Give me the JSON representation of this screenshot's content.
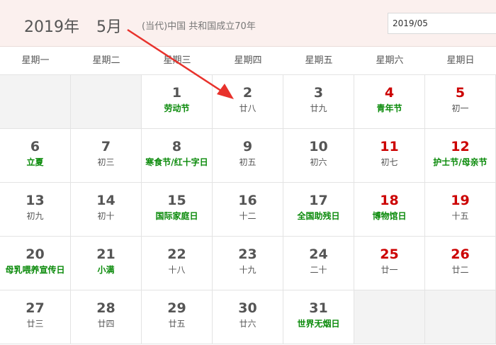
{
  "header": {
    "year": "2019年",
    "month": "5月",
    "info": "(当代)中国 共和国成立70年",
    "date_value": "2019/05"
  },
  "weekdays": [
    "星期一",
    "星期二",
    "星期三",
    "星期四",
    "星期五",
    "星期六",
    "星期日"
  ],
  "calendar": {
    "rows": [
      [
        {
          "empty": true
        },
        {
          "empty": true
        },
        {
          "day": "1",
          "sub": "劳动节",
          "red": false,
          "green": true
        },
        {
          "day": "2",
          "sub": "廿八",
          "red": false,
          "green": false
        },
        {
          "day": "3",
          "sub": "廿九",
          "red": false,
          "green": false
        },
        {
          "day": "4",
          "sub": "青年节",
          "red": true,
          "green": true
        },
        {
          "day": "5",
          "sub": "初一",
          "red": true,
          "green": false
        }
      ],
      [
        {
          "day": "6",
          "sub": "立夏",
          "red": false,
          "green": true
        },
        {
          "day": "7",
          "sub": "初三",
          "red": false,
          "green": false
        },
        {
          "day": "8",
          "sub": "寒食节/红十字日",
          "red": false,
          "green": true
        },
        {
          "day": "9",
          "sub": "初五",
          "red": false,
          "green": false
        },
        {
          "day": "10",
          "sub": "初六",
          "red": false,
          "green": false
        },
        {
          "day": "11",
          "sub": "初七",
          "red": true,
          "green": false
        },
        {
          "day": "12",
          "sub": "护士节/母亲节",
          "red": true,
          "green": true
        }
      ],
      [
        {
          "day": "13",
          "sub": "初九",
          "red": false,
          "green": false
        },
        {
          "day": "14",
          "sub": "初十",
          "red": false,
          "green": false
        },
        {
          "day": "15",
          "sub": "国际家庭日",
          "red": false,
          "green": true
        },
        {
          "day": "16",
          "sub": "十二",
          "red": false,
          "green": false
        },
        {
          "day": "17",
          "sub": "全国助残日",
          "red": false,
          "green": true
        },
        {
          "day": "18",
          "sub": "博物馆日",
          "red": true,
          "green": true
        },
        {
          "day": "19",
          "sub": "十五",
          "red": true,
          "green": false
        }
      ],
      [
        {
          "day": "20",
          "sub": "母乳喂养宣传日",
          "red": false,
          "green": true
        },
        {
          "day": "21",
          "sub": "小满",
          "red": false,
          "green": true
        },
        {
          "day": "22",
          "sub": "十八",
          "red": false,
          "green": false
        },
        {
          "day": "23",
          "sub": "十九",
          "red": false,
          "green": false
        },
        {
          "day": "24",
          "sub": "二十",
          "red": false,
          "green": false
        },
        {
          "day": "25",
          "sub": "廿一",
          "red": true,
          "green": false
        },
        {
          "day": "26",
          "sub": "廿二",
          "red": true,
          "green": false
        }
      ],
      [
        {
          "day": "27",
          "sub": "廿三",
          "red": false,
          "green": false
        },
        {
          "day": "28",
          "sub": "廿四",
          "red": false,
          "green": false
        },
        {
          "day": "29",
          "sub": "廿五",
          "red": false,
          "green": false
        },
        {
          "day": "30",
          "sub": "廿六",
          "red": false,
          "green": false
        },
        {
          "day": "31",
          "sub": "世界无烟日",
          "red": false,
          "green": true
        },
        {
          "empty": true
        },
        {
          "empty": true
        }
      ]
    ]
  },
  "colors": {
    "weekend_red": "#cc0000",
    "holiday_green": "#0a8a0a",
    "header_bg": "#fbf0ee",
    "annotation_arrow": "#e8322c"
  },
  "annotation": {
    "icon": "red-arrow-icon"
  }
}
